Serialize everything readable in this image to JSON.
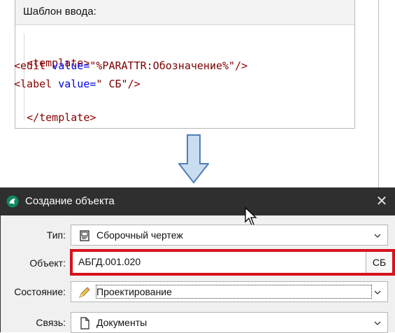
{
  "template_panel": {
    "title": "Шаблон ввода:",
    "lines": [
      {
        "tag_open": "<template>"
      },
      {
        "tag_open": "<edit ",
        "attr": "value=",
        "str": "\"%PARATTR:Обозначение%\"",
        "tag_close": "/>"
      },
      {
        "tag_open": "<label ",
        "attr": "value=",
        "str": "\" СБ\"",
        "tag_close": "/>"
      },
      {
        "tag_open": "</template>"
      }
    ]
  },
  "dialog": {
    "title": "Создание объекта",
    "close_symbol": "✕",
    "fields": {
      "type": {
        "label": "Тип:",
        "value": "Сборочный чертеж"
      },
      "object": {
        "label": "Объект:",
        "value": "АБГД.001.020",
        "suffix_button": "СБ"
      },
      "state": {
        "label": "Состояние:",
        "value": "Проектирование"
      },
      "link": {
        "label": "Связь:",
        "value": "Документы"
      }
    }
  },
  "colors": {
    "titlebar": "#2f2f2f",
    "highlight": "#d6121c",
    "xml_attr": "#0000e6",
    "xml_tag": "#8a0000"
  },
  "icons": {
    "arrow": "down-arrow-icon",
    "app": "app-logo-icon",
    "type": "drawing-icon",
    "state": "pencil-icon",
    "link": "document-icon",
    "cursor": "mouse-pointer-icon"
  }
}
